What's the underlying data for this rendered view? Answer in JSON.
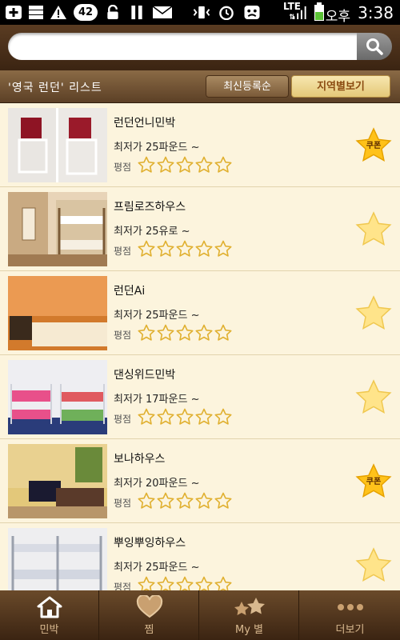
{
  "status_bar": {
    "notification_count": "42",
    "network": "LTE",
    "am_pm": "오후",
    "time": "3:38"
  },
  "search": {
    "value": "",
    "placeholder": ""
  },
  "list_header": {
    "title": "'영국 런던' 리스트",
    "sort_newest_label": "최신등록순",
    "sort_region_label": "지역별보기"
  },
  "listings": [
    {
      "name": "런던언니민박",
      "price": "최저가 25파운드 ~",
      "rating_label": "평점",
      "rating": 0,
      "coupon": true,
      "coupon_label": "쿠폰"
    },
    {
      "name": "프림로즈하우스",
      "price": "최저가 25유로 ~",
      "rating_label": "평점",
      "rating": 0,
      "coupon": false
    },
    {
      "name": "런던Ai",
      "price": "최저가 25파운드 ~",
      "rating_label": "평점",
      "rating": 0,
      "coupon": false
    },
    {
      "name": "댄싱위드민박",
      "price": "최저가 17파운드 ~",
      "rating_label": "평점",
      "rating": 0,
      "coupon": false
    },
    {
      "name": "보나하우스",
      "price": "최저가 20파운드 ~",
      "rating_label": "평점",
      "rating": 0,
      "coupon": true,
      "coupon_label": "쿠폰"
    },
    {
      "name": "뿌잉뿌잉하우스",
      "price": "최저가 25파운드 ~",
      "rating_label": "평점",
      "rating": 0,
      "coupon": false
    }
  ],
  "bottom_nav": {
    "items": [
      {
        "label": "민박",
        "icon": "house-icon",
        "active": true
      },
      {
        "label": "찜",
        "icon": "heart-icon",
        "active": false
      },
      {
        "label": "My 별",
        "icon": "stars-icon",
        "active": false
      },
      {
        "label": "더보기",
        "icon": "more-dots-icon",
        "active": false
      }
    ]
  },
  "colors": {
    "accent": "#f0a818",
    "header_brown": "#5c4026",
    "list_bg": "#fcf4dd",
    "star_outline": "#e0b030",
    "star_fill": "#ffd24a"
  }
}
